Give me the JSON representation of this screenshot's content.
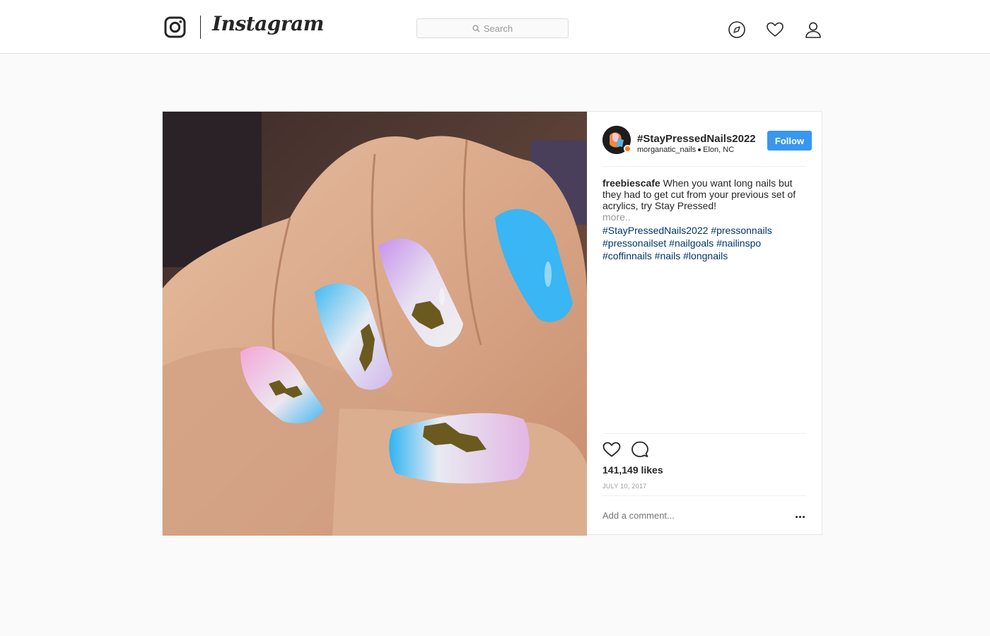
{
  "header": {
    "wordmark": "Instagram",
    "search_placeholder": "Search",
    "icons": [
      "instagram-glyph-icon",
      "explore-compass-icon",
      "activity-heart-icon",
      "profile-user-icon",
      "search-icon"
    ]
  },
  "post": {
    "account_title": "#StayPressedNails2022",
    "username": "morganatic_nails",
    "location": "Elon, NC",
    "follow_label": "Follow",
    "caption_user": "freebiescafe",
    "caption_text": "When you want long nails but they had to get cut from your previous set of acrylics, try Stay Pressed!",
    "more_label": "more..",
    "hashtags": "#StayPressedNails2022 #pressonnails #pressonailset #nailgoals #nailinspo #coffinnails #nails #longnails",
    "likes": "141,149 likes",
    "date": "JULY 10, 2017",
    "comment_placeholder": "Add a comment...",
    "colors": {
      "follow": "#3897f0",
      "hashtag": "#003569",
      "muted": "#999999"
    },
    "action_icons": [
      "like-heart-icon",
      "comment-bubble-icon",
      "more-options-icon"
    ]
  }
}
